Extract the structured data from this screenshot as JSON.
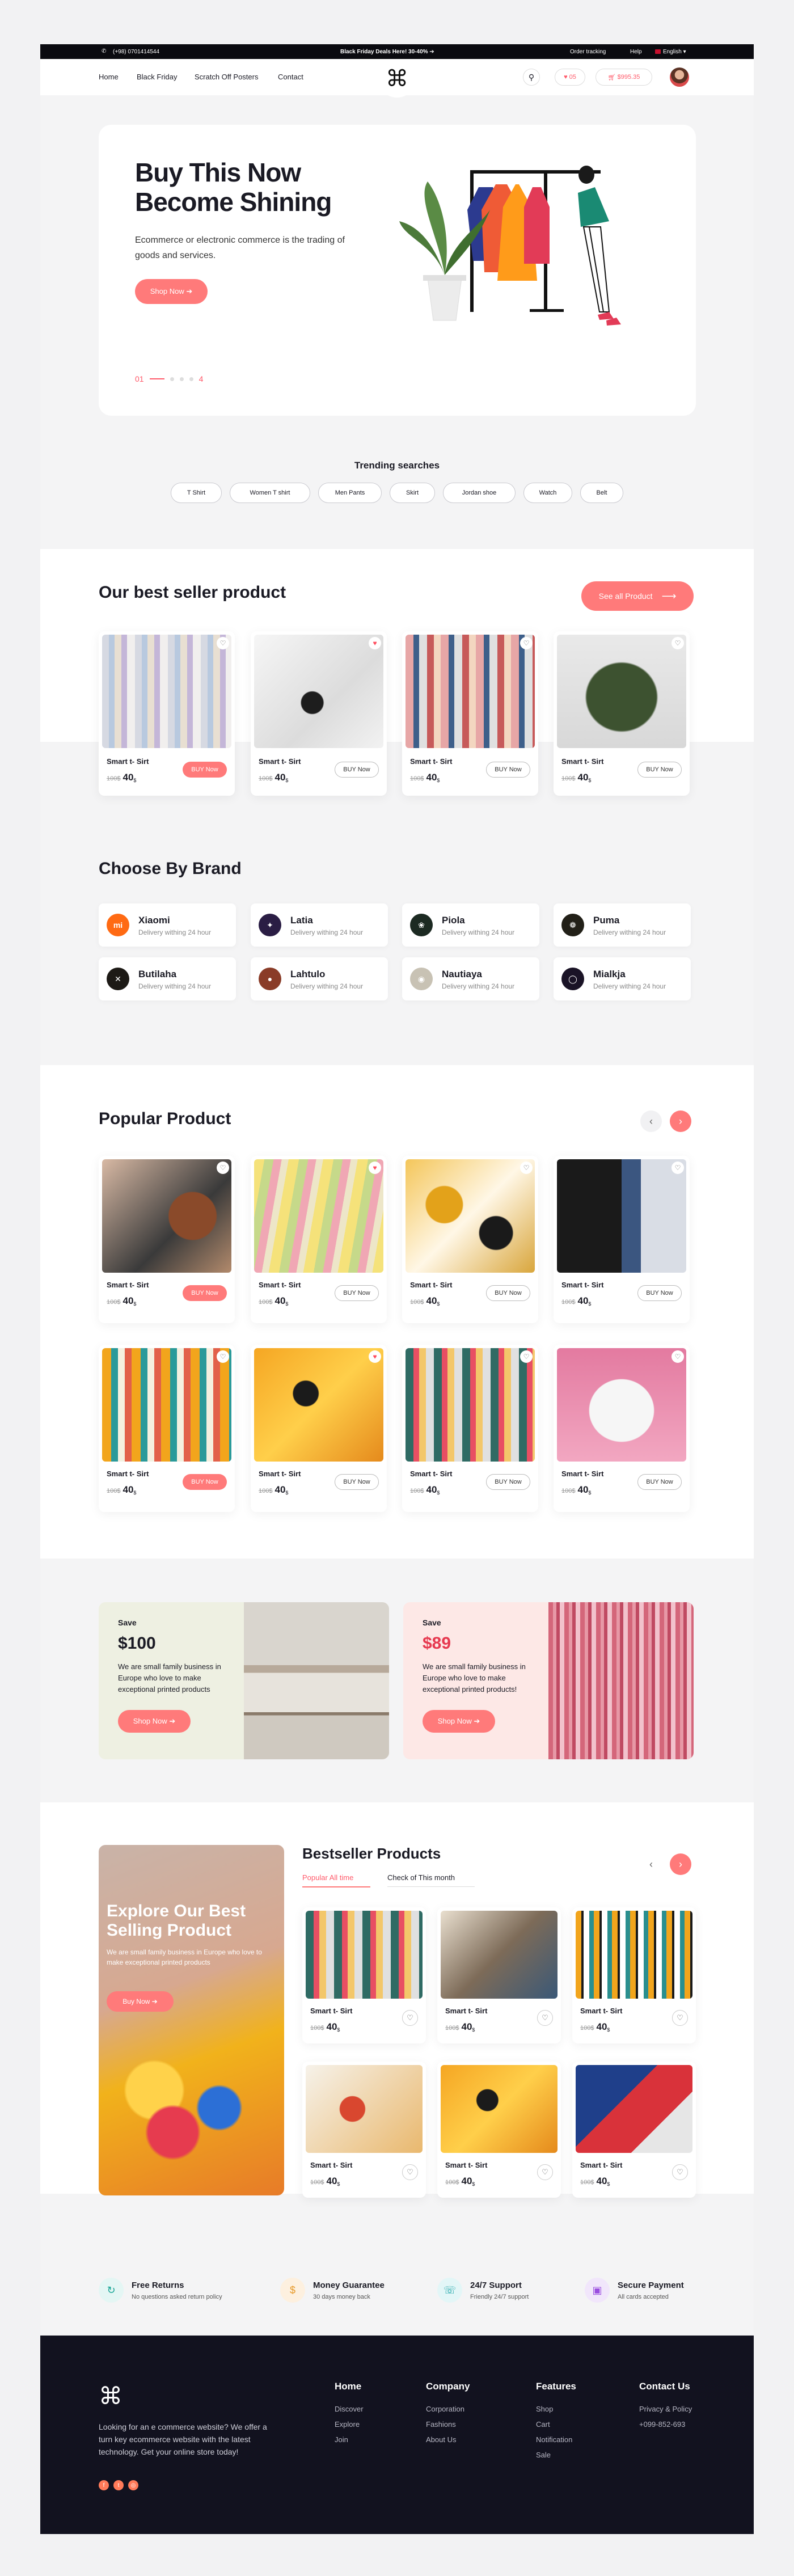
{
  "topbar": {
    "phone": "(+98) 0701414544",
    "promo": "Black Friday Deals Here! 30-40% ➔",
    "order_tracking": "Order tracking",
    "help": "Help",
    "language": "English"
  },
  "nav": {
    "items": [
      "Home",
      "Black Friday",
      "Scratch Off Posters",
      "Contact"
    ],
    "wishlist_count": "05",
    "cart_total": "$995.35"
  },
  "hero": {
    "title_line1": "Buy This Now",
    "title_line2": "Become Shining",
    "desc": "Ecommerce or electronic commerce is the trading of goods and services.",
    "button": "Shop Now ➔",
    "page_current": "01",
    "page_total": "4"
  },
  "trending": {
    "title": "Trending searches",
    "tags": [
      "T Shirt",
      "Women T shirt",
      "Men Pants",
      "Skirt",
      "Jordan shoe",
      "Watch",
      "Belt"
    ]
  },
  "bestseller": {
    "title": "Our best seller product",
    "see_all": "See all Product"
  },
  "product": {
    "name": "Smart t- Sirt",
    "old": "100$",
    "price": "40",
    "currency": "$",
    "buy": "BUY Now"
  },
  "brands": {
    "title": "Choose By Brand",
    "items": [
      {
        "name": "Xiaomi",
        "desc": "Delivery withing 24 hour",
        "color": "#ff6a13",
        "glyph": "mi"
      },
      {
        "name": "Latia",
        "desc": "Delivery withing 24 hour",
        "color": "#2a1d44",
        "glyph": "✦"
      },
      {
        "name": "Piola",
        "desc": "Delivery withing 24 hour",
        "color": "#1c2a22",
        "glyph": "❀"
      },
      {
        "name": "Puma",
        "desc": "Delivery withing 24 hour",
        "color": "#222018",
        "glyph": "❁"
      },
      {
        "name": "Butilaha",
        "desc": "Delivery withing 24 hour",
        "color": "#1d1a16",
        "glyph": "✕"
      },
      {
        "name": "Lahtulo",
        "desc": "Delivery withing 24 hour",
        "color": "#8a3c28",
        "glyph": "●"
      },
      {
        "name": "Nautiaya",
        "desc": "Delivery withing 24 hour",
        "color": "#c8c2b4",
        "glyph": "◉"
      },
      {
        "name": "Mialkja",
        "desc": "Delivery withing 24 hour",
        "color": "#1a1326",
        "glyph": "◯"
      }
    ]
  },
  "popular": {
    "title": "Popular Product"
  },
  "promos": [
    {
      "save": "Save",
      "amount": "$100",
      "desc": "We are small family business in Europe who love to make exceptional printed products",
      "button": "Shop Now ➔"
    },
    {
      "save": "Save",
      "amount": "$89",
      "desc": "We are small family business in Europe who love to make exceptional printed products!",
      "button": "Shop Now ➔"
    }
  ],
  "explore": {
    "title": "Explore Our Best Selling Product",
    "desc": "We are small family business in Europe who love to make exceptional printed products",
    "button": "Buy Now ➔"
  },
  "bs2": {
    "title": "Bestseller Products",
    "tab1": "Popular All time",
    "tab2": "Check of This month"
  },
  "features": [
    {
      "title": "Free Returns",
      "sub": "No questions asked return policy",
      "icon": "↻",
      "bg": "#e4f6f4",
      "color": "#1aa596"
    },
    {
      "title": "Money Guarantee",
      "sub": "30 days money back",
      "icon": "$",
      "bg": "#fdf0df",
      "color": "#e79a2a"
    },
    {
      "title": "24/7 Support",
      "sub": "Friendly 24/7 support",
      "icon": "☏",
      "bg": "#e3f6f7",
      "color": "#1ea5a8"
    },
    {
      "title": "Secure Payment",
      "sub": "All cards accepted",
      "icon": "▣",
      "bg": "#f1e6fb",
      "color": "#9a4de0"
    }
  ],
  "footer": {
    "desc": "Looking for an e commerce website? We offer a turn key ecommerce website with the latest technology. Get your online store today!",
    "cols": [
      {
        "title": "Home",
        "links": [
          "Discover",
          "Explore",
          "Join"
        ]
      },
      {
        "title": "Company",
        "links": [
          "Corporation",
          "Fashions",
          "About Us"
        ]
      },
      {
        "title": "Features",
        "links": [
          "Shop",
          "Cart",
          "Notification",
          "Sale"
        ]
      },
      {
        "title": "Contact Us",
        "links": [
          "Privacy & Policy",
          "+099-852-693"
        ]
      }
    ]
  },
  "colors": {
    "accent": "#ff7a7a",
    "dark": "#12121f"
  }
}
